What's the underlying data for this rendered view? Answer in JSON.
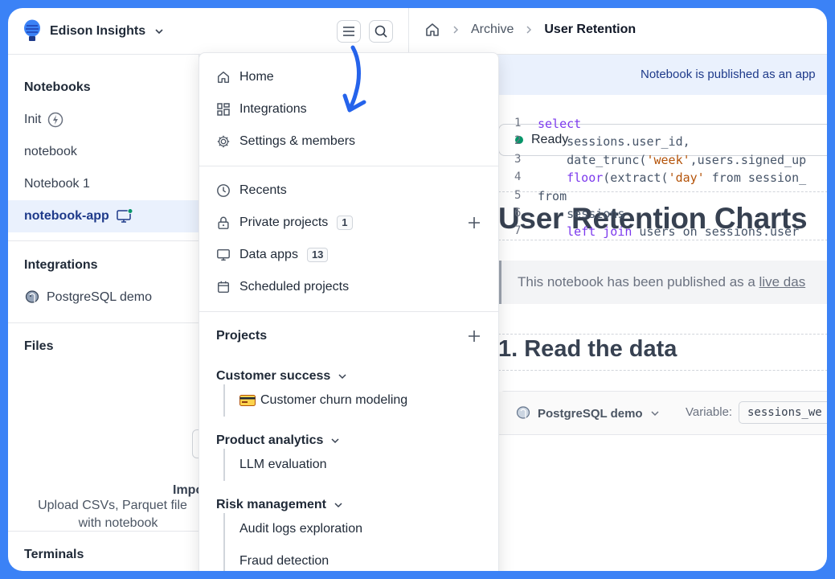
{
  "workspace": {
    "name": "Edison Insights"
  },
  "breadcrumb": {
    "items": [
      "Archive"
    ],
    "current": "User Retention"
  },
  "sidebar": {
    "notebooks_heading": "Notebooks",
    "notebooks": [
      "Init",
      "notebook",
      "Notebook 1"
    ],
    "active_notebook": "notebook-app",
    "integrations_heading": "Integrations",
    "integrations": [
      "PostgreSQL demo"
    ],
    "files_heading": "Files",
    "import_label": "Impo",
    "files_help": "Upload CSVs, Parquet file with notebook",
    "files_help_line1": "Upload CSVs, Parquet file",
    "files_help_line2": "with notebook",
    "terminals_heading": "Terminals"
  },
  "main": {
    "banner": "Notebook is published as an app",
    "status": "Ready",
    "title": "User Retention Charts",
    "quote_prefix": "This notebook has been published as a ",
    "quote_link": "live das",
    "section_title": "1. Read the data",
    "cell": {
      "source": "PostgreSQL demo",
      "variable_label": "Variable:",
      "variable_value": "sessions_we",
      "lines": [
        "select",
        "    sessions.user_id,",
        "    date_trunc('week',users.signed_up",
        "    floor(extract('day' from session_",
        "from",
        "    sessions",
        "    left join users on sessions.user"
      ]
    }
  },
  "menu": {
    "top": [
      "Home",
      "Integrations",
      "Settings & members"
    ],
    "middle": [
      {
        "label": "Recents"
      },
      {
        "label": "Private projects",
        "count": "1"
      },
      {
        "label": "Data apps",
        "count": "13"
      },
      {
        "label": "Scheduled projects"
      }
    ],
    "projects_heading": "Projects",
    "groups": [
      {
        "name": "Customer success",
        "items": [
          "Customer churn modeling"
        ]
      },
      {
        "name": "Product analytics",
        "items": [
          "LLM evaluation"
        ]
      },
      {
        "name": "Risk management",
        "items": [
          "Audit logs exploration",
          "Fraud detection"
        ]
      }
    ]
  },
  "colors": {
    "accent": "#3b82f6",
    "active_bg": "#eaf1fd",
    "status_green": "#059669",
    "link_navy": "#1e3a8a"
  }
}
